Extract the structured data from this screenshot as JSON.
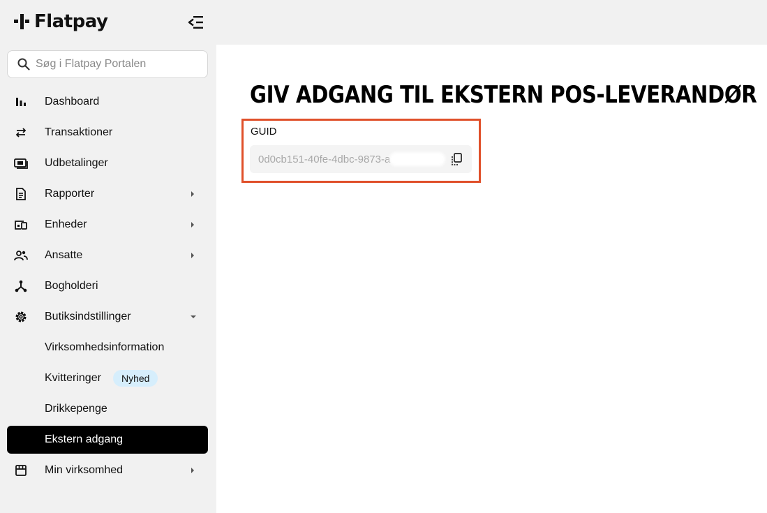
{
  "brand": {
    "name": "Flatpay"
  },
  "search": {
    "placeholder": "Søg i Flatpay Portalen"
  },
  "nav": [
    {
      "label": "Dashboard",
      "icon": "bar-chart-icon"
    },
    {
      "label": "Transaktioner",
      "icon": "swap-arrows-icon"
    },
    {
      "label": "Udbetalinger",
      "icon": "banknote-icon"
    },
    {
      "label": "Rapporter",
      "icon": "document-icon",
      "expandable": true
    },
    {
      "label": "Enheder",
      "icon": "devices-icon",
      "expandable": true
    },
    {
      "label": "Ansatte",
      "icon": "people-icon",
      "expandable": true
    },
    {
      "label": "Bogholderi",
      "icon": "hub-icon"
    },
    {
      "label": "Butiksindstillinger",
      "icon": "gear-icon",
      "expanded": true
    },
    {
      "label": "Virksomhedsinformation",
      "sub": true
    },
    {
      "label": "Kvitteringer",
      "sub": true,
      "badge": "Nyhed"
    },
    {
      "label": "Drikkepenge",
      "sub": true
    },
    {
      "label": "Ekstern adgang",
      "sub": true,
      "active": true
    },
    {
      "label": "Min virksomhed",
      "icon": "store-icon",
      "expandable": true
    }
  ],
  "main": {
    "title": "GIV ADGANG TIL EKSTERN POS-LEVERANDØR",
    "guid": {
      "label": "GUID",
      "value": "0d0cb151-40fe-4dbc-9873-a"
    }
  },
  "colors": {
    "accent_border": "#e0502a",
    "active_bg": "#000000",
    "badge_bg": "#d6eefc"
  }
}
